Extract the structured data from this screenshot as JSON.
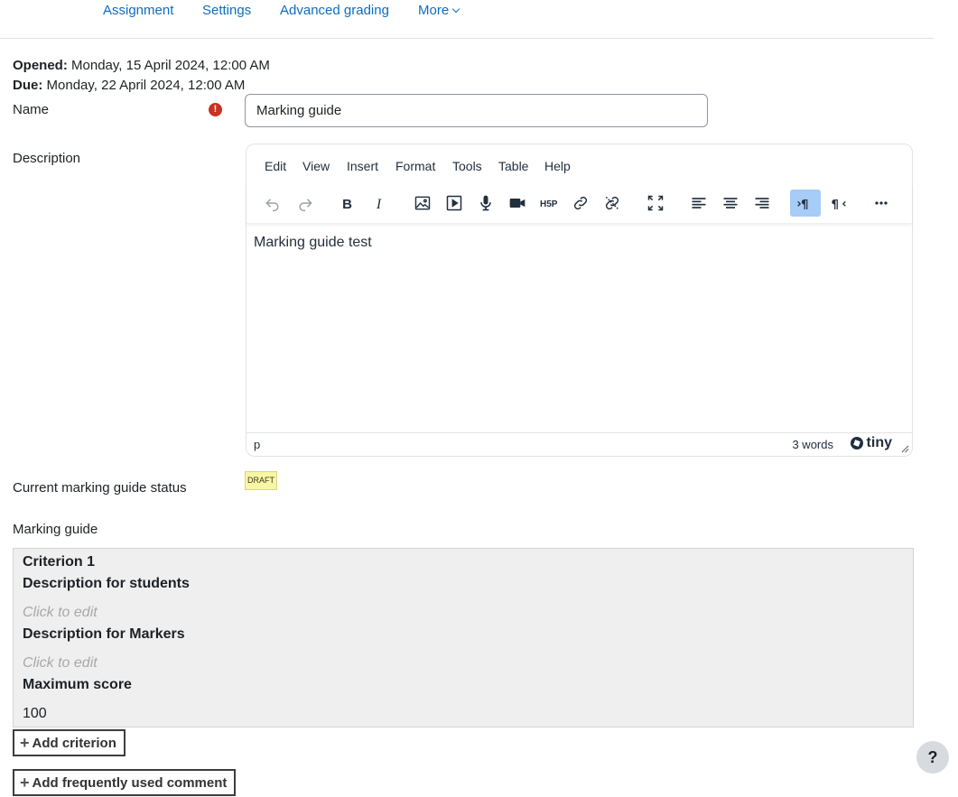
{
  "nav": {
    "assignment": "Assignment",
    "settings": "Settings",
    "advanced_grading": "Advanced grading",
    "more": "More"
  },
  "dates": {
    "opened_label": "Opened:",
    "opened_value": "Monday, 15 April 2024, 12:00 AM",
    "due_label": "Due:",
    "due_value": "Monday, 22 April 2024, 12:00 AM"
  },
  "form": {
    "name_label": "Name",
    "name_required_icon": "exclamation-icon",
    "name_value": "Marking guide",
    "description_label": "Description",
    "status_label": "Current marking guide status",
    "status_badge": "DRAFT",
    "guide_label": "Marking guide"
  },
  "editor": {
    "menu": [
      "Edit",
      "View",
      "Insert",
      "Format",
      "Tools",
      "Table",
      "Help"
    ],
    "toolbar_icons": [
      "undo-icon",
      "redo-icon",
      "bold-icon",
      "italic-icon",
      "image-icon",
      "media-icon",
      "record-audio-icon",
      "record-video-icon",
      "h5p-icon",
      "link-icon",
      "unlink-icon",
      "fullscreen-icon",
      "align-left-icon",
      "align-center-icon",
      "align-right-icon",
      "ltr-icon",
      "rtl-icon",
      "more-icon"
    ],
    "content": "Marking guide test",
    "path": "p",
    "word_count": "3 words",
    "brand": "tiny",
    "active_color": "#a6ccf7"
  },
  "criterion": {
    "title": "Criterion 1",
    "students_label": "Description for students",
    "students_placeholder": "Click to edit",
    "markers_label": "Description for Markers",
    "markers_placeholder": "Click to edit",
    "max_label": "Maximum score",
    "max_value": "100"
  },
  "buttons": {
    "add_criterion": "Add criterion",
    "add_comment": "Add frequently used comment",
    "help": "?"
  },
  "colors": {
    "link": "#0f6cbf",
    "required": "#ca3120",
    "draft_bg": "#f7f6a4"
  }
}
